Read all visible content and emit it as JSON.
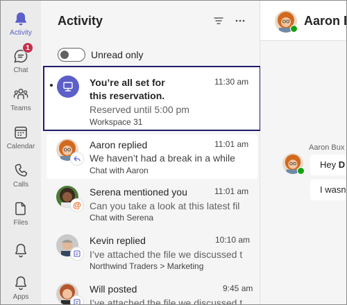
{
  "rail": {
    "items": [
      {
        "label": "Activity",
        "icon": "bell-icon",
        "active": true
      },
      {
        "label": "Chat",
        "icon": "chat-icon",
        "badge": "1"
      },
      {
        "label": "Teams",
        "icon": "teams-icon"
      },
      {
        "label": "Calendar",
        "icon": "calendar-icon"
      },
      {
        "label": "Calls",
        "icon": "phone-icon"
      },
      {
        "label": "Files",
        "icon": "file-icon"
      },
      {
        "label": "",
        "icon": "bell-outline-icon"
      },
      {
        "label": "Apps",
        "icon": "apps-icon"
      }
    ]
  },
  "activity": {
    "title": "Activity",
    "toggle_label": "Unread only",
    "feed": [
      {
        "title_line1": "You’re all set for",
        "title_line2": "this reservation.",
        "time": "11:30 am",
        "body": "Reserved until 5:00 pm",
        "sub": "Workspace 31"
      },
      {
        "title": "Aaron replied",
        "time": "11:01 am",
        "body": "We haven’t had a break in a while",
        "sub": "Chat with Aaron"
      },
      {
        "title": "Serena mentioned you",
        "time": "11:01 am",
        "body": "Can you take a look at this latest fil",
        "sub": "Chat with Serena"
      },
      {
        "title": "Kevin replied",
        "time": "10:10 am",
        "body": "I’ve attached the file we discussed t",
        "sub": "Northwind Traders > Marketing"
      },
      {
        "title": "Will posted",
        "time": "9:45 am",
        "body": "I’ve attached the file we discussed t"
      }
    ]
  },
  "chat": {
    "header_name": "Aaron B",
    "sender": "Aaron Bux",
    "bubble1_prefix": "Hey ",
    "bubble1_bold": "D",
    "bubble2": "I wasn"
  },
  "colors": {
    "accent": "#5b5fc7",
    "badge": "#c4314b",
    "presence": "#13a10e",
    "highlight_border": "#1f1b6e"
  }
}
